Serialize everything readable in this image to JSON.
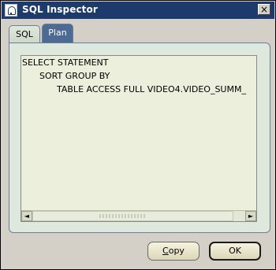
{
  "window": {
    "title": "SQL Inspector",
    "close_glyph": "×"
  },
  "tabs": [
    {
      "label": "SQL",
      "selected": false
    },
    {
      "label": "Plan",
      "selected": true
    }
  ],
  "plan": {
    "lines": [
      "SELECT STATEMENT",
      "SORT GROUP BY",
      "TABLE ACCESS FULL VIDEO4.VIDEO_SUMM_"
    ]
  },
  "scrollbar": {
    "left_glyph": "◄",
    "right_glyph": "►"
  },
  "buttons": {
    "copy_mnemonic": "C",
    "copy_rest": "opy",
    "ok": "OK"
  },
  "icons": {
    "app": "app-icon",
    "close": "close-icon"
  }
}
